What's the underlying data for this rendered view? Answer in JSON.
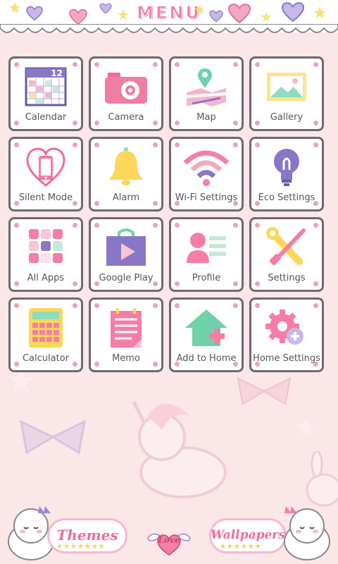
{
  "header": {
    "title": "MENU"
  },
  "grid": {
    "tiles": [
      {
        "label": "Calendar",
        "icon": "calendar-icon",
        "badge": "12"
      },
      {
        "label": "Camera",
        "icon": "camera-icon"
      },
      {
        "label": "Map",
        "icon": "map-icon"
      },
      {
        "label": "Gallery",
        "icon": "gallery-icon"
      },
      {
        "label": "Silent Mode",
        "icon": "silent-mode-icon"
      },
      {
        "label": "Alarm",
        "icon": "alarm-bell-icon"
      },
      {
        "label": "Wi-Fi Settings",
        "icon": "wifi-icon"
      },
      {
        "label": "Eco Settings",
        "icon": "lightbulb-icon"
      },
      {
        "label": "All Apps",
        "icon": "all-apps-icon"
      },
      {
        "label": "Google Play",
        "icon": "google-play-icon"
      },
      {
        "label": "Profile",
        "icon": "profile-icon"
      },
      {
        "label": "Settings",
        "icon": "wrench-screwdriver-icon"
      },
      {
        "label": "Calculator",
        "icon": "calculator-icon"
      },
      {
        "label": "Memo",
        "icon": "memo-icon"
      },
      {
        "label": "Add to Home",
        "icon": "add-to-home-icon"
      },
      {
        "label": "Home Settings",
        "icon": "gear-plus-icon"
      }
    ]
  },
  "footer": {
    "themes_label": "Themes",
    "wallpapers_label": "Wallpapers",
    "love_label": "Love"
  },
  "colors": {
    "accent_pink": "#f07ea6",
    "tile_border": "#6e6a6e",
    "background": "#fbe6e8"
  }
}
